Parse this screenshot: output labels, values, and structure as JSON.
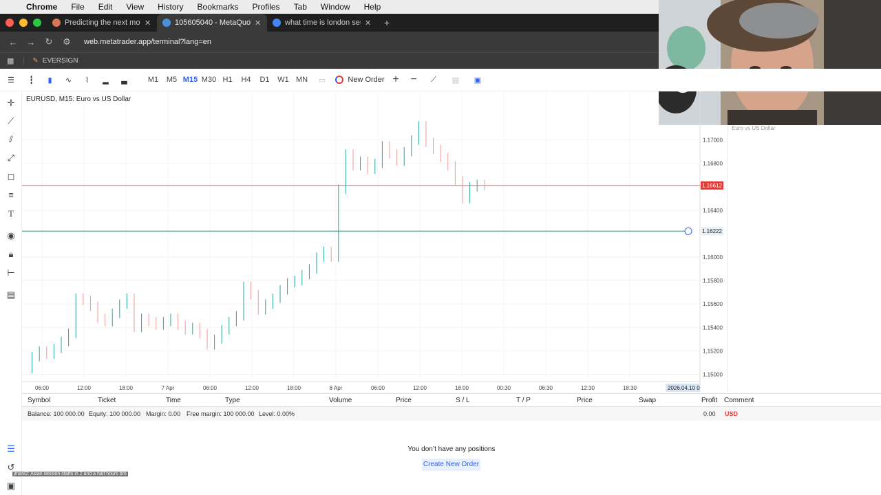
{
  "mac_menu": {
    "app": "Chrome",
    "items": [
      "File",
      "Edit",
      "View",
      "History",
      "Bookmarks",
      "Profiles",
      "Tab",
      "Window",
      "Help"
    ]
  },
  "tabs": [
    {
      "title": "Predicting the next move - Cl",
      "color": "#d97757",
      "active": false
    },
    {
      "title": "105605040 - MetaQuotes-De",
      "color": "#4a90d9",
      "active": true
    },
    {
      "title": "what time is london session -",
      "color": "#4285f4",
      "active": false
    }
  ],
  "address": {
    "url": "web.metatrader.app/terminal?lang=en"
  },
  "bookmark": {
    "label": "EVERSIGN"
  },
  "toolbar": {
    "timeframes": [
      "M1",
      "M5",
      "M15",
      "M30",
      "H1",
      "H4",
      "D1",
      "W1",
      "MN"
    ],
    "active_timeframe": "M15",
    "new_order_label": "New Order"
  },
  "chart": {
    "symbol_title": "EURUSD, M15: Euro vs US Dollar",
    "right_panel_label": "Euro vs US Dollar",
    "price_ticks": [
      "1.17000",
      "1.16800",
      "1.16400",
      "1.16000",
      "1.15800",
      "1.15600",
      "1.15400",
      "1.15200",
      "1.15000"
    ],
    "current_price": "1.16612",
    "hline_price": "1.16222",
    "time_ticks": [
      "06:00",
      "12:00",
      "18:00",
      "7 Apr",
      "06:00",
      "12:00",
      "18:00",
      "8 Apr",
      "06:00",
      "12:00",
      "18:00",
      "00:30",
      "06:30",
      "12:30",
      "18:30"
    ],
    "time_end_label": "2026.04.10 0"
  },
  "chart_data": {
    "type": "line",
    "title": "EURUSD, M15: Euro vs US Dollar",
    "ylim": [
      1.1495,
      1.1725
    ],
    "series": [
      {
        "name": "EURUSD",
        "values": [
          1.1505,
          1.1515,
          1.152,
          1.1517,
          1.1522,
          1.1528,
          1.1535,
          1.1565,
          1.1563,
          1.1558,
          1.1548,
          1.1545,
          1.1552,
          1.156,
          1.1565,
          1.154,
          1.1548,
          1.1545,
          1.1542,
          1.1545,
          1.1548,
          1.1542,
          1.1538,
          1.154,
          1.1535,
          1.1525,
          1.153,
          1.1538,
          1.1545,
          1.155,
          1.1575,
          1.1568,
          1.1555,
          1.156,
          1.1565,
          1.1572,
          1.1578,
          1.158,
          1.1585,
          1.159,
          1.16,
          1.1605,
          1.16,
          1.1658,
          1.1688,
          1.1678,
          1.1682,
          1.1675,
          1.168,
          1.1695,
          1.1688,
          1.1682,
          1.169,
          1.17,
          1.1712,
          1.1698,
          1.1692,
          1.1685,
          1.1678,
          1.1665,
          1.165,
          1.166,
          1.1662,
          1.1661
        ]
      }
    ]
  },
  "trade_table": {
    "headers": [
      "Symbol",
      "Ticket",
      "Time",
      "Type",
      "Volume",
      "Price",
      "S / L",
      "T / P",
      "Price",
      "Swap",
      "Profit",
      "Comment"
    ],
    "balance": "Balance: 100 000.00",
    "equity": "Equity: 100 000.00",
    "margin": "Margin: 0.00",
    "free_margin": "Free margin: 100 000.00",
    "level": "Level: 0.00%",
    "profit": "0.00",
    "currency": "USD",
    "empty_message": "You don’t have any positions",
    "create_button": "Create New Order"
  },
  "ticker": {
    "text": "jmanl2: Asian session starts in 2 and a half hours bro"
  },
  "colors": {
    "current_line": "#e57373",
    "hline": "#4a9a8a",
    "tag_red": "#e53935",
    "accent": "#2962ff"
  }
}
